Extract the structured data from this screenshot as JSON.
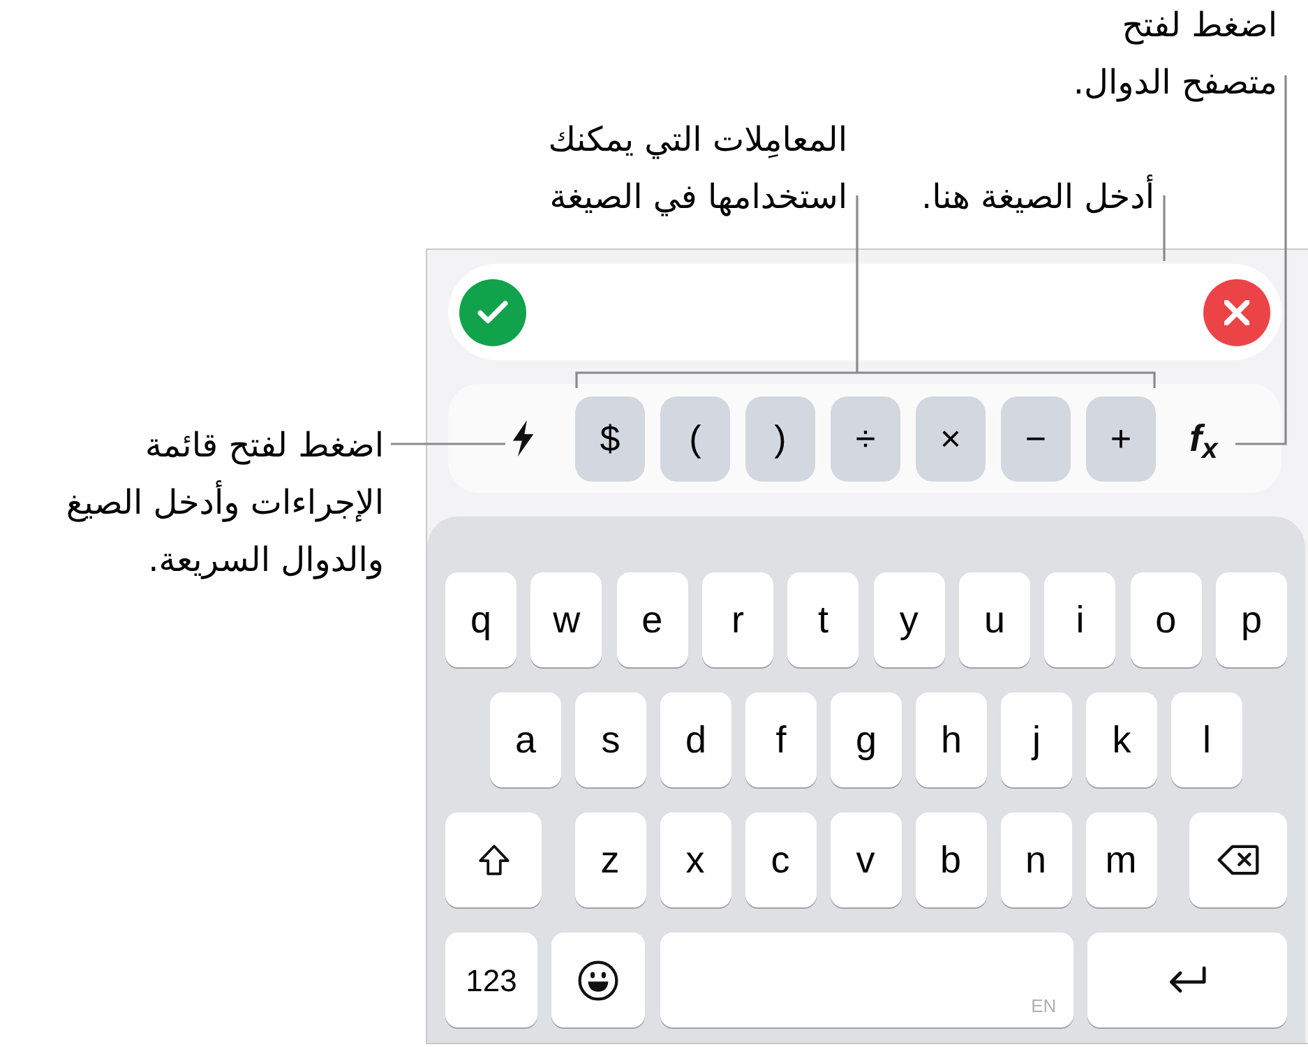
{
  "callouts": [
    {
      "kind": "functions",
      "lines": [
        "اضغط لفتح",
        "متصفح الدوال."
      ]
    },
    {
      "kind": "formula",
      "lines": [
        "أدخل الصيغة هنا."
      ]
    },
    {
      "kind": "operators",
      "lines": [
        "المعامِلات التي يمكنك",
        "استخدامها في الصيغة"
      ]
    },
    {
      "kind": "actions",
      "lines": [
        "اضغط لفتح قائمة",
        "الإجراءات وأدخل الصيغ",
        "والدوال السريعة."
      ]
    }
  ],
  "operator_bar": {
    "operators": [
      "+",
      "−",
      "×",
      "÷",
      ")",
      "(",
      "$"
    ],
    "functions_button": "f$_{x}$"
  },
  "keyboard": {
    "letter_rows": [
      [
        "p",
        "o",
        "i",
        "u",
        "y",
        "t",
        "r",
        "e",
        "w",
        "q"
      ],
      [
        "l",
        "k",
        "j",
        "h",
        "g",
        "f",
        "d",
        "s",
        "a"
      ],
      [
        "m",
        "n",
        "b",
        "v",
        "c",
        "x",
        "z"
      ]
    ],
    "numbers_key": "123",
    "space_language": "EN"
  }
}
